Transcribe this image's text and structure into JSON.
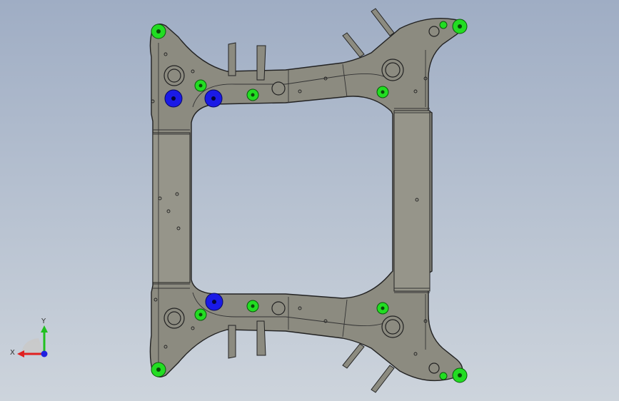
{
  "viewport": {
    "background_top": "#9fadc4",
    "background_bottom": "#cdd4dc"
  },
  "model": {
    "body_color": "#8c8b80",
    "edge_color": "#222222",
    "highlight_color": "#b9b8ad",
    "fixture_green": "#22dd22",
    "fixture_blue": "#1a1ae6"
  },
  "triad": {
    "x_label": "X",
    "y_label": "Y",
    "x_color": "#e02020",
    "y_color": "#20c020",
    "z_color": "#2020e0"
  }
}
